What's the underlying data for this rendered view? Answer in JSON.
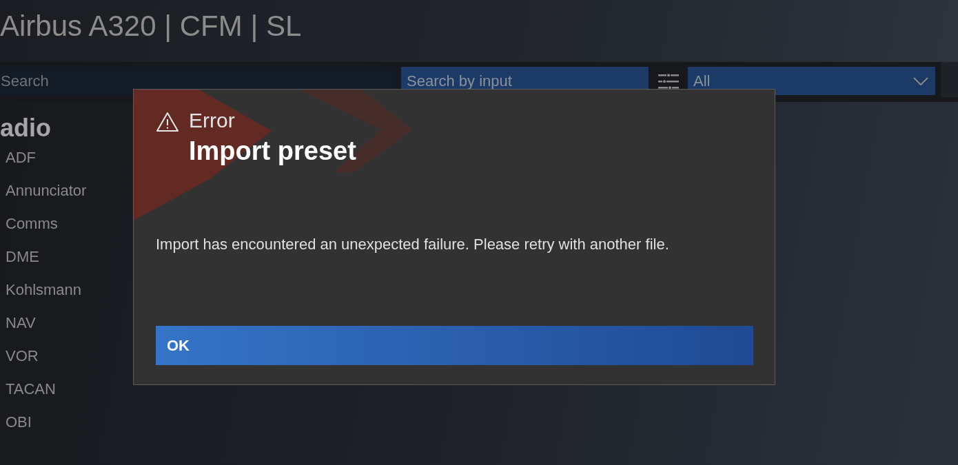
{
  "header": {
    "title": "Airbus A320 | CFM | SL"
  },
  "toolbar": {
    "search": {
      "placeholder": "Search"
    },
    "input_search": {
      "placeholder": "Search by input"
    },
    "filter": {
      "value": "All"
    }
  },
  "sidebar": {
    "heading": "adio",
    "items": [
      {
        "label": "ADF"
      },
      {
        "label": "Annunciator"
      },
      {
        "label": "Comms"
      },
      {
        "label": "DME"
      },
      {
        "label": "Kohlsmann"
      },
      {
        "label": "NAV"
      },
      {
        "label": "VOR"
      },
      {
        "label": "TACAN"
      },
      {
        "label": "OBI"
      }
    ]
  },
  "dialog": {
    "kind": "error",
    "label": "Error",
    "title": "Import preset",
    "message": "Import has encountered an unexpected failure. Please retry with another file.",
    "buttons": [
      {
        "label": "OK"
      }
    ]
  }
}
